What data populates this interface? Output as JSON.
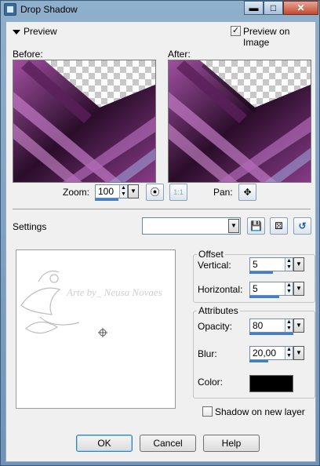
{
  "window": {
    "title": "Drop Shadow",
    "close_glyph": "✕",
    "min_glyph": "▬",
    "max_glyph": "□"
  },
  "preview_section": {
    "label": "Preview",
    "preview_on_image_label": "Preview on Image",
    "preview_on_image_checked": true
  },
  "before_label": "Before:",
  "after_label": "After:",
  "zoom": {
    "label": "Zoom:",
    "value": "100"
  },
  "pan": {
    "label": "Pan:"
  },
  "settings": {
    "label": "Settings",
    "value": ""
  },
  "canvas": {
    "watermark_text": "Arte by_ Neusa Novaes"
  },
  "offset": {
    "title": "Offset",
    "vertical_label": "Vertical:",
    "vertical_value": "5",
    "horizontal_label": "Horizontal:",
    "horizontal_value": "5"
  },
  "attributes": {
    "title": "Attributes",
    "opacity_label": "Opacity:",
    "opacity_value": "80",
    "blur_label": "Blur:",
    "blur_value": "20,00",
    "color_label": "Color:",
    "color_value": "#000000"
  },
  "shadow_on_new_layer": {
    "label": "Shadow on new layer",
    "checked": false
  },
  "buttons": {
    "ok": "OK",
    "cancel": "Cancel",
    "help": "Help"
  },
  "icons": {
    "checkmark": "✓",
    "spin_up": "▲",
    "spin_down": "▼",
    "dropdown": "▼",
    "move": "✥",
    "proof": "⦿",
    "fit": "1:1",
    "save": "💾",
    "randomize": "⚄",
    "reset": "↺",
    "crosshair": "⌖"
  }
}
